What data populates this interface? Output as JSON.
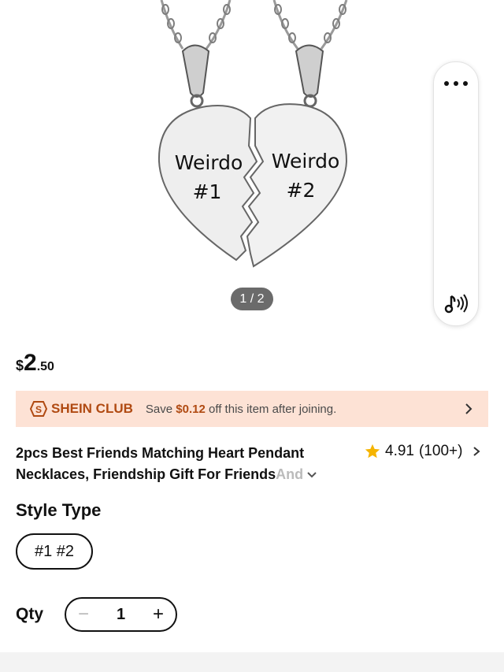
{
  "gallery": {
    "pendant_left_text_1": "Weirdo",
    "pendant_left_text_2": "#1",
    "pendant_right_text_1": "Weirdo",
    "pendant_right_text_2": "#2",
    "counter": "1 / 2"
  },
  "floating_bar": {
    "more_icon": "more-horizontal-icon",
    "sound_icon": "music-sound-icon"
  },
  "price": {
    "currency": "$",
    "integer": "2",
    "decimal": ".50"
  },
  "club": {
    "label": "SHEIN CLUB",
    "msg_prefix": "Save ",
    "amount": "$0.12",
    "msg_suffix": " off this item after joining.",
    "accent": "#b04a12",
    "background": "#fde2d5"
  },
  "product": {
    "title_line1": "2pcs Best Friends Matching Heart Pendant",
    "title_line2": "Necklaces, Friendship Gift For Friends ",
    "title_fade": "And",
    "rating": "4.91",
    "reviews": "(100+)"
  },
  "style": {
    "title": "Style Type",
    "option": "#1 #2"
  },
  "quantity": {
    "label": "Qty",
    "minus": "−",
    "value": "1",
    "plus": "+"
  }
}
